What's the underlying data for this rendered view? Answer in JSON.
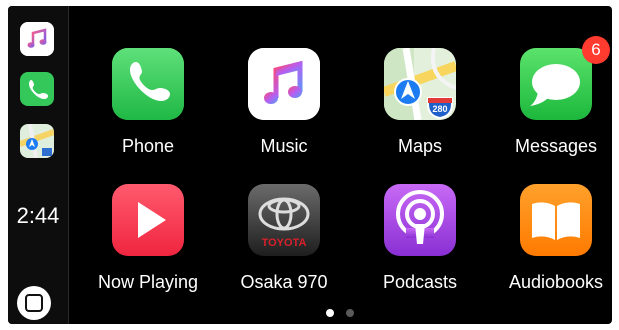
{
  "sidebar": {
    "clock": "2:44",
    "recent_apps": [
      {
        "icon": "music-icon"
      },
      {
        "icon": "phone-icon"
      },
      {
        "icon": "maps-icon"
      }
    ],
    "home_button_icon": "home-square-icon"
  },
  "apps": [
    {
      "label": "Phone",
      "icon": "phone-icon"
    },
    {
      "label": "Music",
      "icon": "music-note-icon"
    },
    {
      "label": "Maps",
      "icon": "maps-icon"
    },
    {
      "label": "Messages",
      "icon": "speech-bubble-icon",
      "badge": "6"
    },
    {
      "label": "Now Playing",
      "icon": "play-icon"
    },
    {
      "label": "Osaka 970",
      "icon": "toyota-logo-icon",
      "logo_text": "TOYOTA"
    },
    {
      "label": "Podcasts",
      "icon": "podcast-icon"
    },
    {
      "label": "Audiobooks",
      "icon": "open-book-icon"
    }
  ],
  "maps_shield_number": "280",
  "page_indicator": {
    "pages": 2,
    "current": 1
  },
  "colors": {
    "phone_green": "#34c759",
    "messages_green": "#30c74f",
    "now_playing_red": "#ff3b4f",
    "podcasts_purple": "#a44be2",
    "audiobooks_orange": "#ff8a00",
    "badge_red": "#ff3b30",
    "background": "#000000"
  }
}
